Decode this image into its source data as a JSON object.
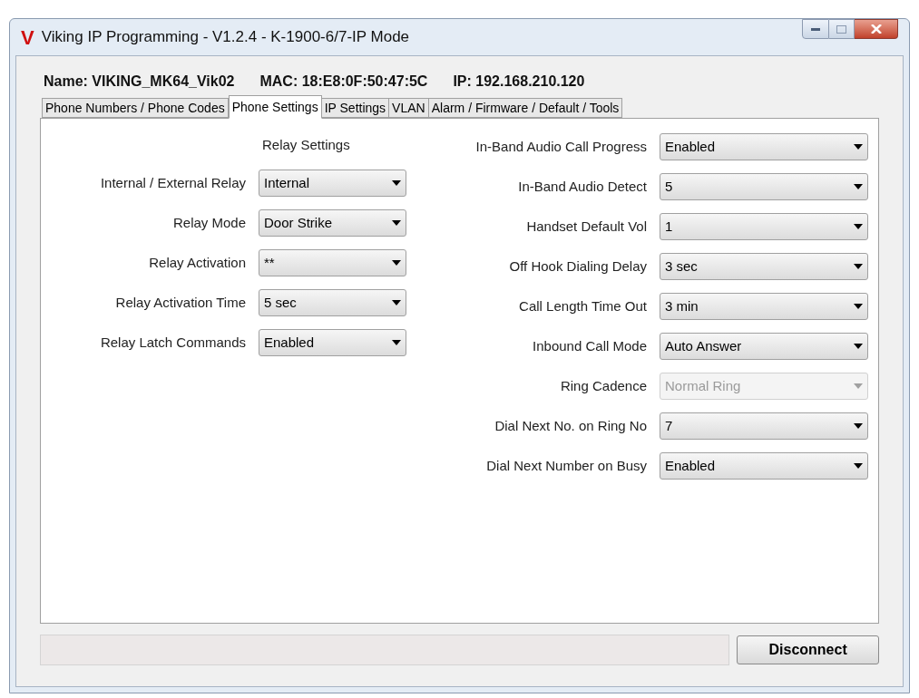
{
  "window": {
    "logo": "V",
    "title": "Viking IP Programming - V1.2.4 - K-1900-6/7-IP Mode"
  },
  "info": [
    "Name: VIKING_MK64_Vik02",
    "MAC: 18:E8:0F:50:47:5C",
    "IP: 192.168.210.120"
  ],
  "tabs": [
    {
      "label": "Phone Numbers / Phone Codes",
      "selected": false
    },
    {
      "label": "Phone Settings",
      "selected": true
    },
    {
      "label": "IP Settings",
      "selected": false
    },
    {
      "label": "VLAN",
      "selected": false
    },
    {
      "label": "Alarm / Firmware / Default / Tools",
      "selected": false
    }
  ],
  "relay_settings": {
    "heading": "Relay Settings",
    "fields": [
      {
        "label": "Internal / External Relay",
        "value": "Internal",
        "disabled": false
      },
      {
        "label": "Relay Mode",
        "value": "Door Strike",
        "disabled": false
      },
      {
        "label": "Relay Activation",
        "value": "**",
        "disabled": false
      },
      {
        "label": "Relay Activation Time",
        "value": "5 sec",
        "disabled": false
      },
      {
        "label": "Relay Latch Commands",
        "value": "Enabled",
        "disabled": false
      }
    ]
  },
  "phone_fields": [
    {
      "label": "In-Band Audio Call Progress",
      "value": "Enabled",
      "disabled": false
    },
    {
      "label": "In-Band Audio Detect",
      "value": "5",
      "disabled": false
    },
    {
      "label": "Handset Default Vol",
      "value": "1",
      "disabled": false
    },
    {
      "label": "Off Hook Dialing Delay",
      "value": "3 sec",
      "disabled": false
    },
    {
      "label": "Call Length Time Out",
      "value": "3 min",
      "disabled": false
    },
    {
      "label": "Inbound Call Mode",
      "value": "Auto Answer",
      "disabled": false
    },
    {
      "label": "Ring Cadence",
      "value": "Normal Ring",
      "disabled": true
    },
    {
      "label": "Dial Next No. on Ring No",
      "value": "7",
      "disabled": false
    },
    {
      "label": "Dial Next Number on Busy",
      "value": "Enabled",
      "disabled": false
    }
  ],
  "buttons": [
    "Disconnect"
  ]
}
